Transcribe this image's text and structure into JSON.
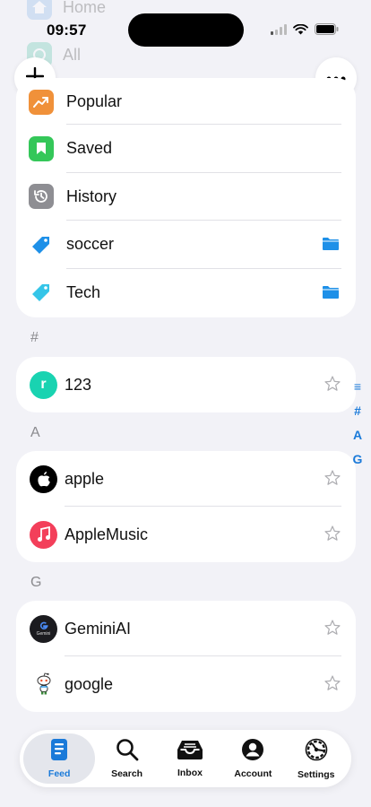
{
  "status": {
    "time": "09:57"
  },
  "ghost_rows": [
    {
      "label": "Home",
      "icon": "home-icon"
    },
    {
      "label": "All",
      "icon": "all-icon"
    }
  ],
  "quick_list": [
    {
      "label": "Popular",
      "icon": "trending-icon",
      "color": "#f0913a"
    },
    {
      "label": "Saved",
      "icon": "bookmark-icon",
      "color": "#34c759"
    },
    {
      "label": "History",
      "icon": "history-icon",
      "color": "#8e8e93"
    },
    {
      "label": "soccer",
      "icon": "tag-icon",
      "color": "#1e90e8",
      "folder": true
    },
    {
      "label": "Tech",
      "icon": "tag-icon",
      "color": "#35c5e8",
      "folder": true
    }
  ],
  "sections": [
    {
      "header": "#",
      "items": [
        {
          "name": "123",
          "avatar_letter": "r",
          "avatar_color": "#19d3b1"
        }
      ]
    },
    {
      "header": "A",
      "items": [
        {
          "name": "apple",
          "avatar_icon": "apple-icon"
        },
        {
          "name": "AppleMusic",
          "avatar_icon": "music-note-icon"
        }
      ]
    },
    {
      "header": "G",
      "items": [
        {
          "name": "GeminiAI",
          "avatar_icon": "google-g-icon",
          "avatar_caption": "Gemini"
        },
        {
          "name": "google",
          "avatar_icon": "reddit-snoo-icon"
        }
      ]
    }
  ],
  "index_bar": [
    "≡",
    "#",
    "A",
    "G"
  ],
  "tabs": [
    {
      "label": "Feed",
      "icon": "feed-icon",
      "active": true
    },
    {
      "label": "Search",
      "icon": "search-icon"
    },
    {
      "label": "Inbox",
      "icon": "inbox-icon"
    },
    {
      "label": "Account",
      "icon": "account-icon"
    },
    {
      "label": "Settings",
      "icon": "settings-icon"
    }
  ],
  "colors": {
    "accent": "#1a7ad9",
    "background": "#f2f2f7"
  }
}
